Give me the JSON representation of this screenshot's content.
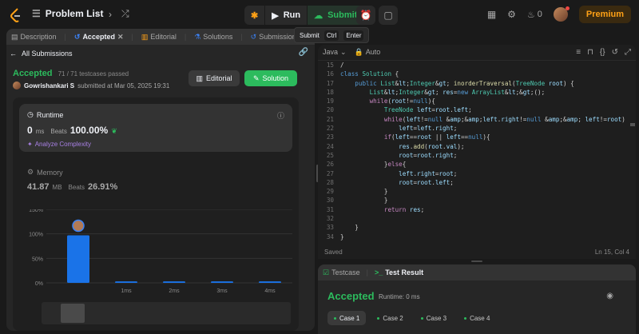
{
  "topbar": {
    "problem_list": "Problem List",
    "run": "Run",
    "submit": "Submit",
    "streak": "0",
    "premium": "Premium",
    "accent": "#ffa116",
    "green": "#2cbb5d"
  },
  "tooltip": {
    "label": "Submit",
    "k1": "Ctrl",
    "k2": "Enter"
  },
  "left": {
    "tabs": [
      "Description",
      "Accepted",
      "Editorial",
      "Solutions",
      "Submissions"
    ],
    "all_submissions": "All Submissions",
    "status": "Accepted",
    "passed": "71 / 71 testcases passed",
    "author": "Gowrishankari S",
    "submitted_text": "submitted at Mar 05, 2025 19:31",
    "editorial_btn": "Editorial",
    "solution_btn": "Solution",
    "runtime": {
      "title": "Runtime",
      "value": "0",
      "unit": "ms",
      "beats_label": "Beats",
      "beats": "100.00%",
      "analyze": "Analyze Complexity"
    },
    "memory": {
      "title": "Memory",
      "value": "41.87",
      "unit": "MB",
      "beats_label": "Beats",
      "beats": "26.91%"
    }
  },
  "chart_data": {
    "type": "bar",
    "categories": [
      "",
      "1ms",
      "2ms",
      "3ms",
      "4ms"
    ],
    "values": [
      97,
      3,
      3,
      3,
      3
    ],
    "ylim": [
      0,
      150
    ],
    "yticks": [
      "0%",
      "50%",
      "100%",
      "150%"
    ],
    "grid": true,
    "color": "#1a73e8"
  },
  "editor": {
    "language": "Java",
    "mode": "Auto",
    "status_left": "Saved",
    "status_right": "Ln 15, Col 4",
    "lines": [
      {
        "n": "15",
        "t": "/"
      },
      {
        "n": "16",
        "t": "class Solution {"
      },
      {
        "n": "17",
        "t": "    public List<Integer> inorderTraversal(TreeNode root) {"
      },
      {
        "n": "18",
        "t": "        List<Integer> res=new ArrayList<>();"
      },
      {
        "n": "19",
        "t": "        while(root!=null){"
      },
      {
        "n": "20",
        "t": "            TreeNode left=root.left;"
      },
      {
        "n": "21",
        "t": "            while(left!=null &&left.right!=null && left!=root)"
      },
      {
        "n": "22",
        "t": "                left=left.right;"
      },
      {
        "n": "23",
        "t": "            if(left==root || left==null){"
      },
      {
        "n": "24",
        "t": "                res.add(root.val);"
      },
      {
        "n": "25",
        "t": "                root=root.right;"
      },
      {
        "n": "26",
        "t": "            }else{"
      },
      {
        "n": "27",
        "t": "                left.right=root;"
      },
      {
        "n": "28",
        "t": "                root=root.left;"
      },
      {
        "n": "29",
        "t": "            }"
      },
      {
        "n": "30",
        "t": "            }"
      },
      {
        "n": "31",
        "t": "            return res;"
      },
      {
        "n": "32",
        "t": ""
      },
      {
        "n": "33",
        "t": "    }"
      },
      {
        "n": "34",
        "t": "}"
      }
    ]
  },
  "result": {
    "tab1": "Testcase",
    "tab2": "Test Result",
    "status": "Accepted",
    "runtime": "Runtime: 0 ms",
    "cases": [
      "Case 1",
      "Case 2",
      "Case 3",
      "Case 4"
    ]
  }
}
